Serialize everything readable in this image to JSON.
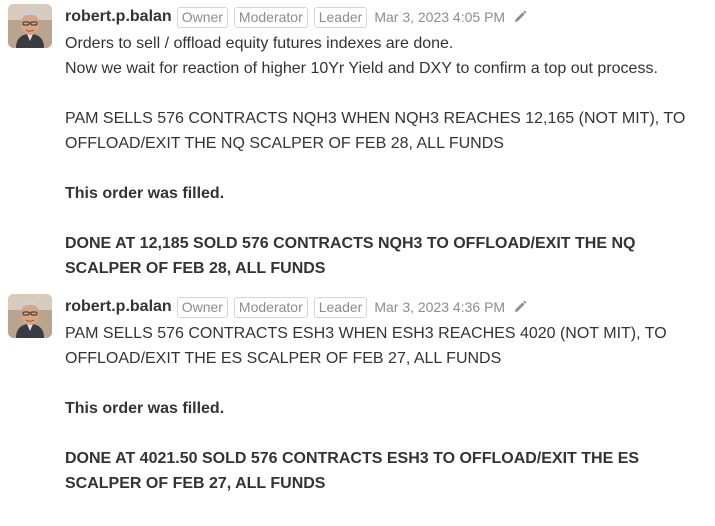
{
  "messages": [
    {
      "sender": "robert.p.balan",
      "badges": [
        "Owner",
        "Moderator",
        "Leader"
      ],
      "timestamp": "Mar 3, 2023 4:05 PM",
      "edit_icon": "pencil-icon",
      "lines": [
        "Orders to sell / offload equity futures indexes are done.",
        "Now we wait for reaction of higher 10Yr Yield and DXY to confirm a top out process.",
        "",
        "PAM SELLS 576 CONTRACTS NQH3 WHEN NQH3 REACHES 12,165 (NOT MIT), TO",
        "OFFLOAD/EXIT THE NQ SCALPER OF FEB 28, ALL FUNDS",
        "",
        "This order was filled.",
        "",
        "DONE AT 12,185 SOLD 576 CONTRACTS NQH3 TO OFFLOAD/EXIT THE NQ",
        "SCALPER OF FEB 28, ALL FUNDS"
      ]
    },
    {
      "sender": "robert.p.balan",
      "badges": [
        "Owner",
        "Moderator",
        "Leader"
      ],
      "timestamp": "Mar 3, 2023 4:36 PM",
      "edit_icon": "pencil-icon",
      "lines": [
        "PAM SELLS 576 CONTRACTS ESH3 WHEN ESH3 REACHES 4020 (NOT MIT), TO",
        "OFFLOAD/EXIT THE ES SCALPER OF FEB 27, ALL FUNDS",
        "",
        "This order was filled.",
        "",
        "DONE AT 4021.50 SOLD 576 CONTRACTS ESH3 TO OFFLOAD/EXIT THE ES",
        "SCALPER OF FEB 27, ALL FUNDS"
      ]
    }
  ],
  "colors": {
    "text": "#333333",
    "muted": "#8d8d8d",
    "badge_border": "#d5d5d5"
  }
}
